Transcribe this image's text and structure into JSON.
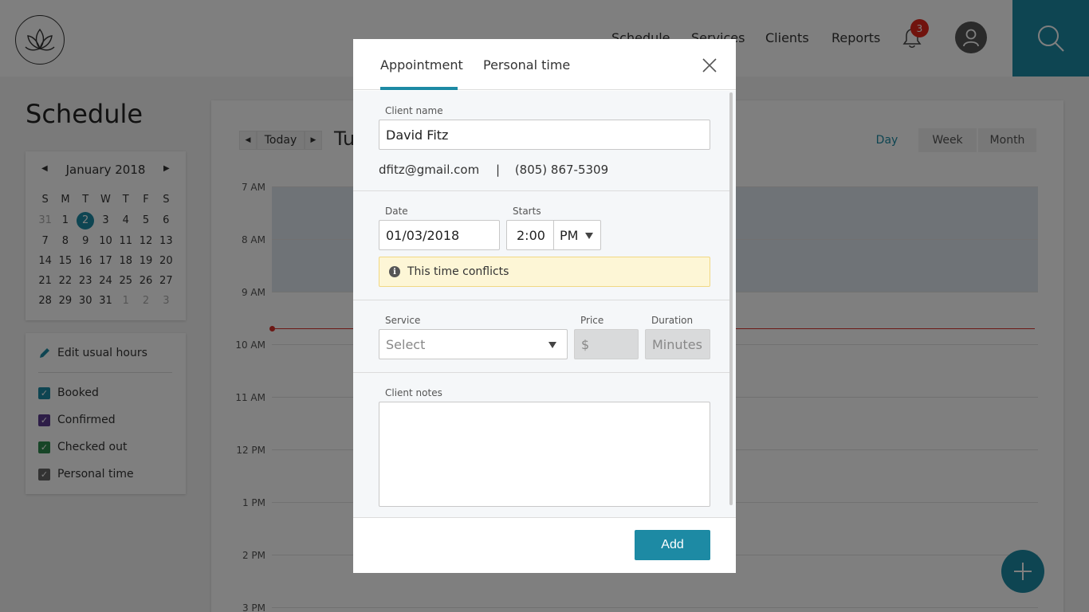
{
  "colors": {
    "accent": "#1d8aa4",
    "alert": "#e2261a",
    "warning_bg": "#fdf6d6"
  },
  "nav": {
    "items": [
      "Schedule",
      "Services",
      "Clients",
      "Reports"
    ],
    "notification_count": "3"
  },
  "sidebar": {
    "page_title": "Schedule",
    "calendar": {
      "month_label": "January 2018",
      "weekdays": [
        "S",
        "M",
        "T",
        "W",
        "T",
        "F",
        "S"
      ],
      "weeks": [
        [
          "31",
          "1",
          "2",
          "3",
          "4",
          "5",
          "6"
        ],
        [
          "7",
          "8",
          "9",
          "10",
          "11",
          "12",
          "13"
        ],
        [
          "14",
          "15",
          "16",
          "17",
          "18",
          "19",
          "20"
        ],
        [
          "21",
          "22",
          "23",
          "24",
          "25",
          "26",
          "27"
        ],
        [
          "28",
          "29",
          "30",
          "31",
          "1",
          "2",
          "3"
        ]
      ],
      "selected_day": "2"
    },
    "edit_hours_label": "Edit usual hours",
    "legend": [
      {
        "label": "Booked",
        "color": "#1d8aa4"
      },
      {
        "label": "Confirmed",
        "color": "#5b3a8e"
      },
      {
        "label": "Checked out",
        "color": "#2e8a4e"
      },
      {
        "label": "Personal time",
        "color": "#666666"
      }
    ]
  },
  "schedule": {
    "today_label": "Today",
    "day_title_partial": "Tu",
    "views": [
      "Day",
      "Week",
      "Month"
    ],
    "active_view": "Day",
    "hours": [
      "7 AM",
      "8 AM",
      "9 AM",
      "10 AM",
      "11 AM",
      "12 PM",
      "1 PM",
      "2 PM",
      "3 PM"
    ]
  },
  "modal": {
    "tabs": [
      "Appointment",
      "Personal time"
    ],
    "active_tab": "Appointment",
    "client_name_label": "Client name",
    "client_name_value": "David Fitz",
    "client_email": "dfitz@gmail.com",
    "contact_separator": "|",
    "client_phone": "(805) 867-5309",
    "date_label": "Date",
    "date_value": "01/03/2018",
    "starts_label": "Starts",
    "starts_time": "2:00",
    "starts_period": "PM",
    "conflict_message": "This time conflicts",
    "service_label": "Service",
    "service_placeholder": "Select",
    "price_label": "Price",
    "price_placeholder": "$",
    "duration_label": "Duration",
    "duration_placeholder": "Minutes",
    "notes_label": "Client notes",
    "notes_value": "",
    "add_button_label": "Add"
  }
}
